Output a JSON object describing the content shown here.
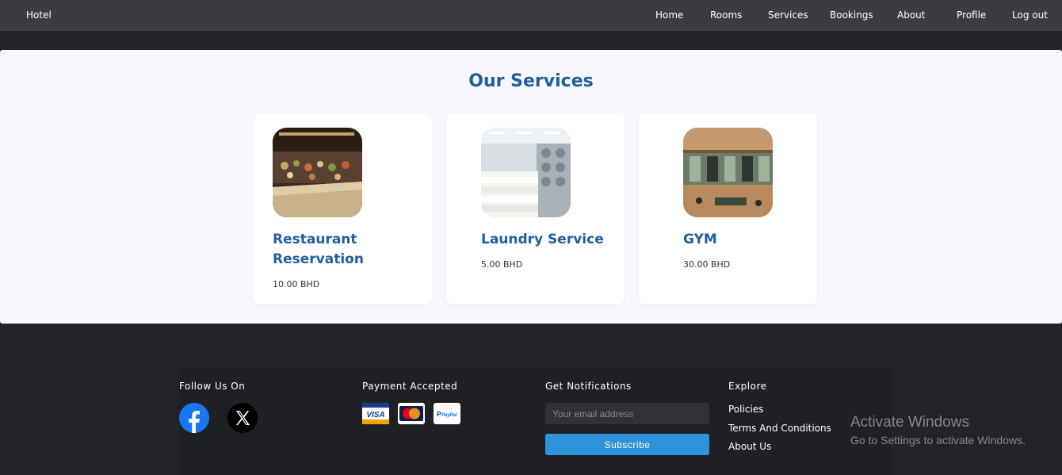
{
  "navbar": {
    "brand": "Hotel",
    "links": [
      "Home",
      "Rooms",
      "Services",
      "Bookings",
      "About",
      "Profile",
      "Log out"
    ]
  },
  "services": {
    "title": "Our Services",
    "cards": [
      {
        "title": "Restaurant Reservation",
        "price": "10.00 BHD",
        "image_icon": "restaurant-buffet-photo"
      },
      {
        "title": "Laundry Service",
        "price": "5.00 BHD",
        "image_icon": "laundry-room-photo"
      },
      {
        "title": "GYM",
        "price": "30.00 BHD",
        "image_icon": "gym-interior-photo"
      }
    ]
  },
  "footer": {
    "follow": {
      "heading": "Follow Us On",
      "icons": [
        "facebook-icon",
        "x-icon"
      ]
    },
    "payment": {
      "heading": "Payment Accepted",
      "icons": [
        "visa-icon",
        "mastercard-icon",
        "paypal-icon"
      ]
    },
    "notifications": {
      "heading": "Get Notifications",
      "email_value": "",
      "email_placeholder": "Your email address",
      "subscribe_label": "Subscribe"
    },
    "explore": {
      "heading": "Explore",
      "links": [
        "Policies",
        "Terms And Conditions",
        "About Us"
      ]
    }
  },
  "watermark": {
    "title": "Activate Windows",
    "subtitle": "Go to Settings to activate Windows."
  },
  "colors": {
    "accent": "#1f5fa0",
    "subscribe": "#2f93d9",
    "navbar": "#3b3c3f",
    "page_bg": "#222326"
  }
}
